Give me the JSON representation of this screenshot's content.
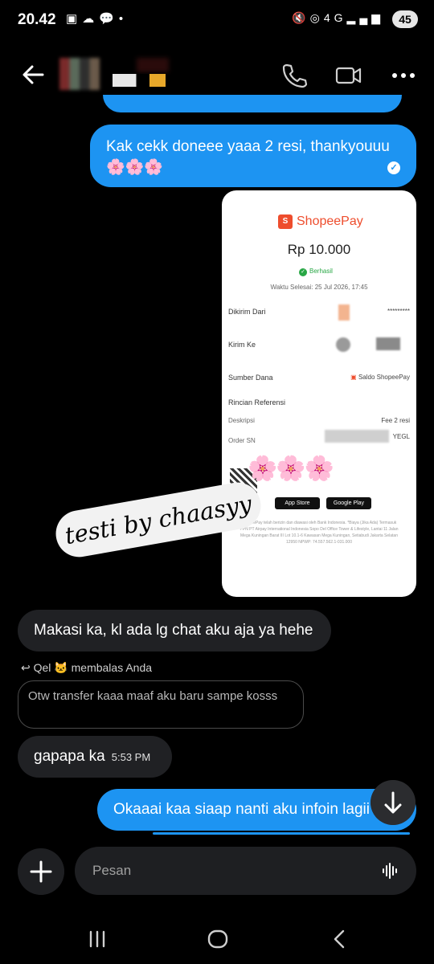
{
  "status_bar": {
    "time": "20.42",
    "left_icons": [
      "screenshot-icon",
      "cloud-icon",
      "chat-icon",
      "dot-icon"
    ],
    "right_icons": [
      "mute-icon",
      "hotspot-icon",
      "4g-icon",
      "signal-icon",
      "signal-icon"
    ],
    "battery": "45"
  },
  "header": {
    "icons": [
      "back-arrow-icon",
      "phone-icon",
      "video-icon",
      "more-icon"
    ]
  },
  "messages": {
    "m1_text": "Kak cekk doneee yaaa 2 resi, thankyouuu",
    "m1_emoji": "🌸🌸🌸",
    "receipt": {
      "brand": "ShopeePay",
      "amount": "Rp 10.000",
      "status": "Berhasil",
      "time": "Waktu Selesai: 25 Jul 2026, 17:45",
      "sent_from_label": "Dikirim Dari",
      "sent_from_value": "*********",
      "sent_to_label": "Kirim Ke",
      "fund_label": "Sumber Dana",
      "fund_value": "Saldo ShopeePay",
      "ref_label": "Rincian Referensi",
      "desc_label": "Deskripsi",
      "desc_value": "Fee 2 resi",
      "order_label": "Order SN",
      "order_value": "YEGL",
      "app_store": "App Store",
      "google_play": "Google Play",
      "footer": "ShopeePay telah berizin dan diawasi oleh Bank Indonesia. *Biaya (Jika Ada) Termasuk PPN PT Airpay International Indonesia Sopo Del Office Tower & Lifestyle, Lantai 11 Jalan Mega Kuningan Barat III Lot 10.1-6 Kawasan Mega Kuningan, Setiabudi Jakarta Selatan 12950 NPWP: 74.557.562.1-031.000",
      "sticker_text": "testi by chaasyy",
      "flowers": "🌸🌸🌸"
    },
    "m2_text": "Makasi ka, kl ada lg chat aku aja ya hehe",
    "reply_label": "Qel 🐱 membalas Anda",
    "reply_quote": "Otw transfer kaaa maaf aku baru sampe kosss",
    "m3_text": "gapapa ka",
    "m3_time": "5:53 PM",
    "m4_text": "Okaaai kaa siaap nanti aku infoin lagii"
  },
  "composer": {
    "placeholder": "Pesan"
  },
  "nav": {
    "icons": [
      "recents-icon",
      "home-icon",
      "back-icon"
    ]
  }
}
